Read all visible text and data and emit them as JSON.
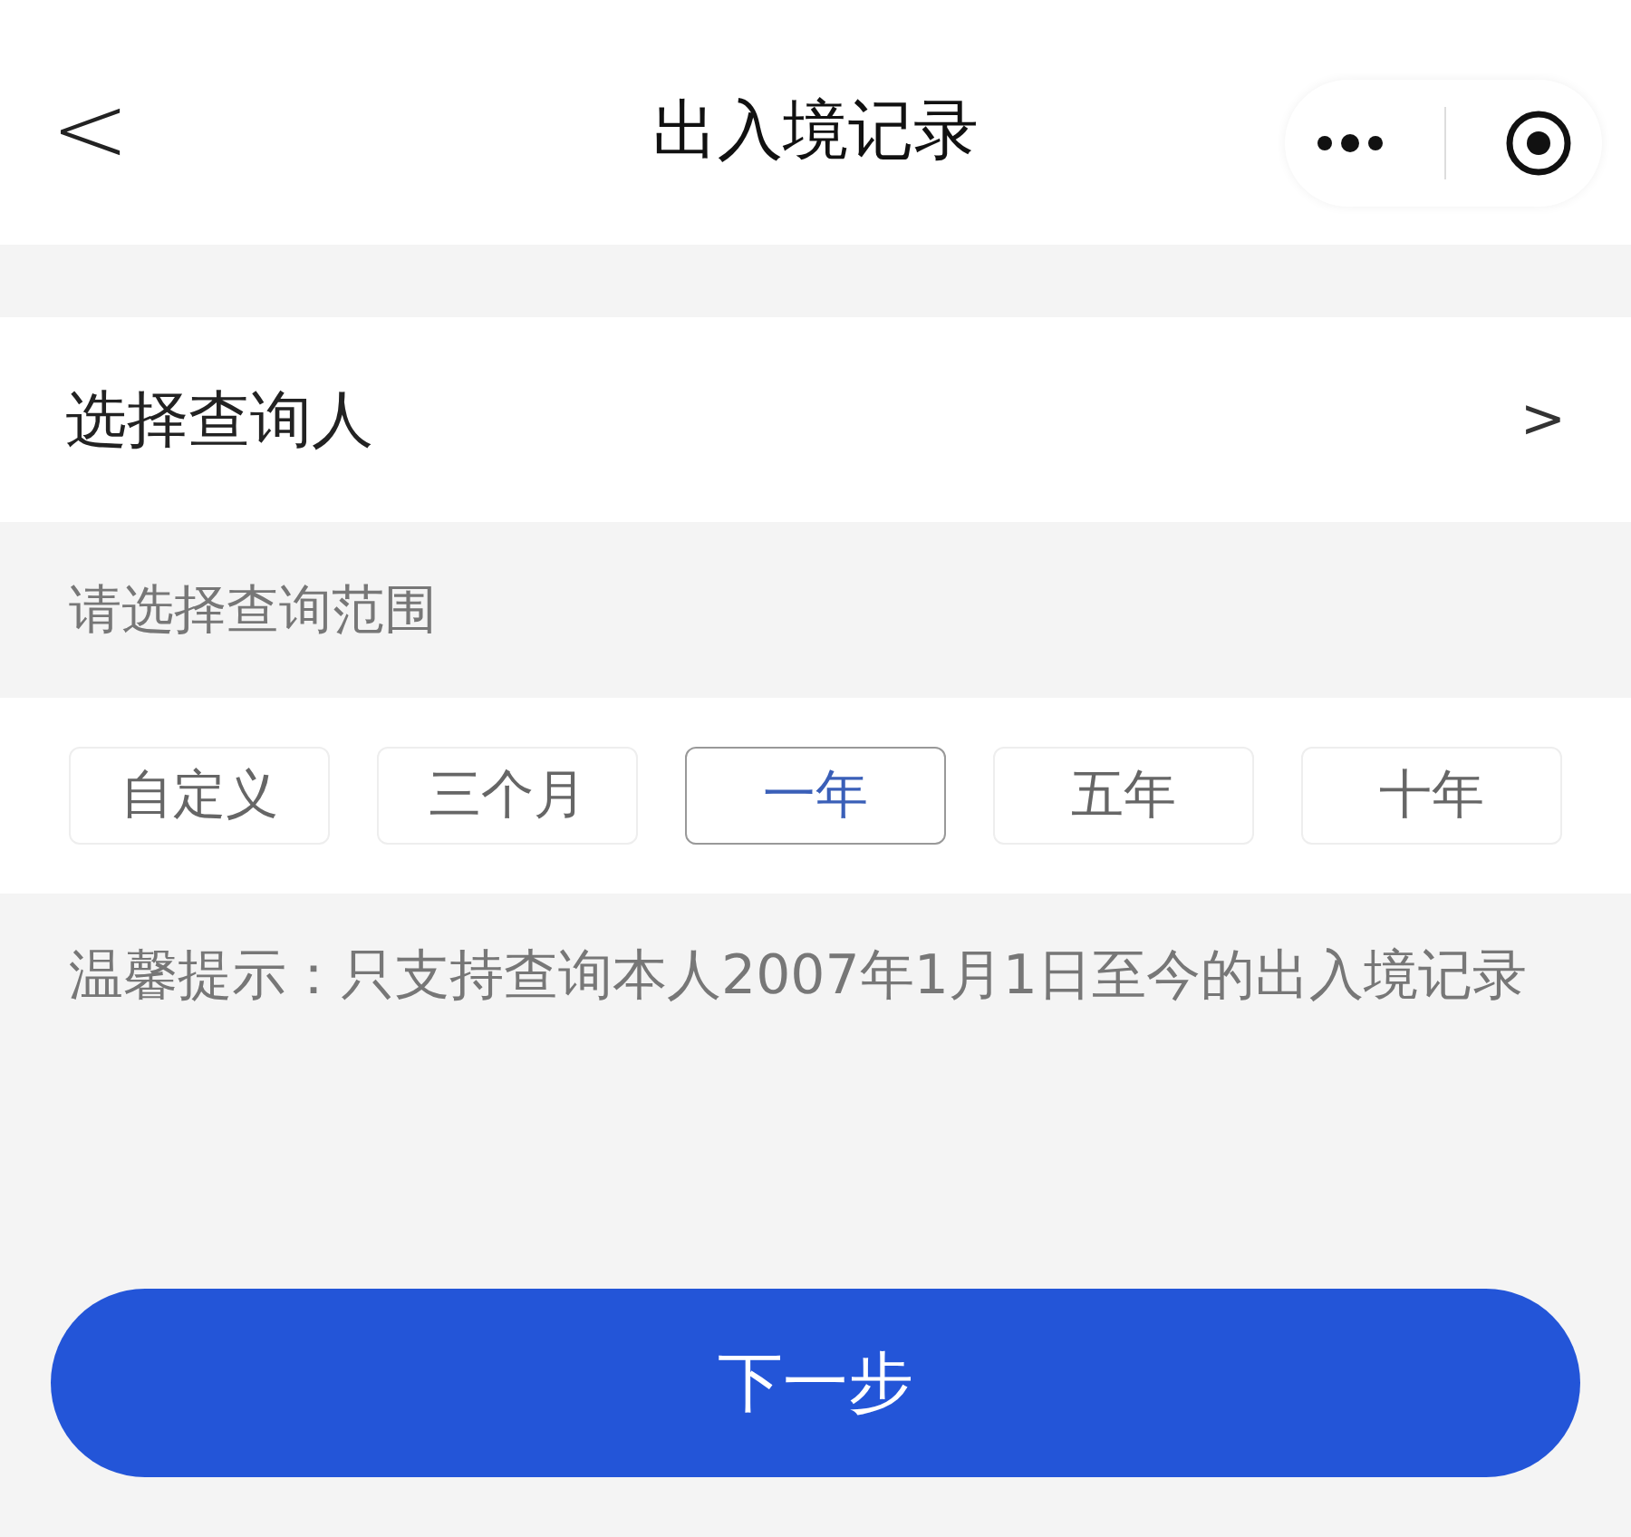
{
  "header": {
    "back": "<",
    "title": "出入境记录"
  },
  "person_row": {
    "label": "选择查询人",
    "chevron": ">"
  },
  "range_label": "请选择查询范围",
  "ranges": [
    {
      "label": "自定义",
      "selected": false
    },
    {
      "label": "三个月",
      "selected": false
    },
    {
      "label": "一年",
      "selected": true
    },
    {
      "label": "五年",
      "selected": false
    },
    {
      "label": "十年",
      "selected": false
    }
  ],
  "tip": "温馨提示：只支持查询本人2007年1月1日至今的出入境记录",
  "next_button": "下一步"
}
